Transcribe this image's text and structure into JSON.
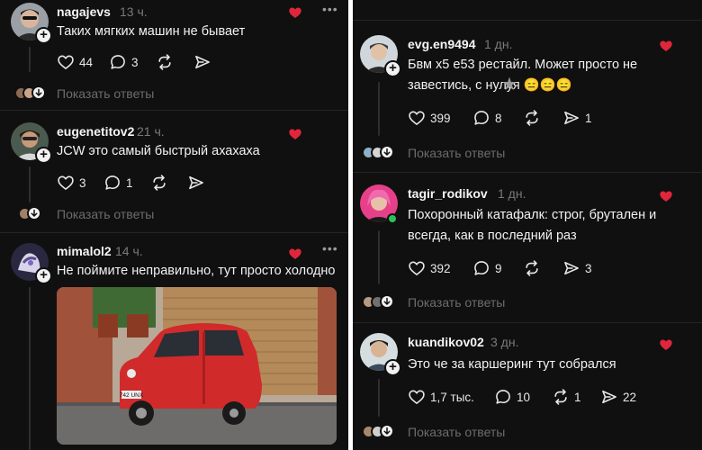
{
  "left_posts": [
    {
      "username": "nagajevs",
      "time": "13 ч.",
      "text": "Таких мягких машин не бывает",
      "likes": "44",
      "comments": "3",
      "reposts": "",
      "shares": "",
      "show_replies": "Показать ответы"
    },
    {
      "username": "eugenetitov2",
      "time": "21 ч.",
      "text": "JCW это самый быстрый ахахаха",
      "likes": "3",
      "comments": "1",
      "reposts": "",
      "shares": "",
      "show_replies": "Показать ответы"
    },
    {
      "username": "mimalol2",
      "time": "14 ч.",
      "text": "Не поймите неправильно, тут просто холодно",
      "photo_plate": "742 UNX"
    }
  ],
  "right_posts": [
    {
      "username": "evg.en9494",
      "time": "1 дн.",
      "text": "Бвм х5 е53 рестайл. Может просто не завестись, с нулуя 😑😑😑",
      "likes": "399",
      "comments": "8",
      "reposts": "",
      "shares": "1",
      "show_replies": "Показать ответы"
    },
    {
      "username": "tagir_rodikov",
      "time": "1 дн.",
      "text": "Похоронный катафалк: строг, брутален и всегда, как в последний раз",
      "likes": "392",
      "comments": "9",
      "reposts": "",
      "shares": "3",
      "show_replies": "Показать ответы"
    },
    {
      "username": "kuandikov02",
      "time": "3 дн.",
      "text": "Это че за каршеринг тут собрался",
      "likes": "1,7 тыс.",
      "comments": "10",
      "reposts": "1",
      "shares": "22",
      "show_replies": "Показать ответы"
    }
  ],
  "icons": {
    "like": "heart-outline-icon",
    "comment": "speech-bubble-icon",
    "repost": "repost-arrows-icon",
    "share": "paper-plane-icon",
    "more": "ellipsis-icon",
    "follow": "plus-icon",
    "author_like": "red-heart-icon",
    "replies": "arrow-down-icon"
  },
  "colors": {
    "background": "#101010",
    "text": "#f2f2f2",
    "muted": "#7a7a7a",
    "heart": "#e0263c",
    "online": "#29c25a"
  }
}
